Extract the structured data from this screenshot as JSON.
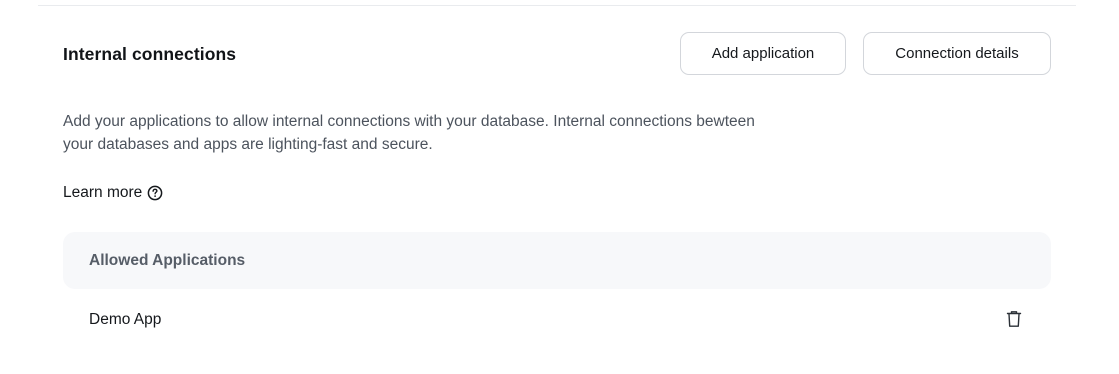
{
  "section": {
    "title": "Internal connections",
    "add_application_label": "Add application",
    "connection_details_label": "Connection details",
    "description": "Add your applications to allow internal connections with your database. Internal connections bewteen your databases and apps are lighting-fast and secure.",
    "learn_more_label": "Learn more"
  },
  "table": {
    "header": "Allowed Applications",
    "rows": [
      {
        "name": "Demo App",
        "action_icon": "trash-icon"
      }
    ]
  },
  "icons": {
    "help": "question-circle-icon",
    "delete": "trash-icon"
  },
  "colors": {
    "text_primary": "#15181c",
    "text_secondary": "#4c535d",
    "table_header_bg": "#f7f8fa",
    "button_border": "#d3d6db"
  }
}
